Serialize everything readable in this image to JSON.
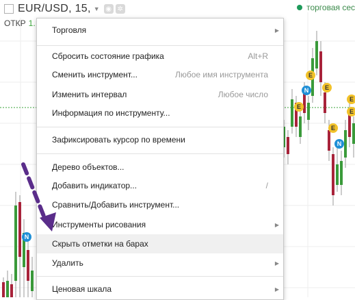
{
  "header": {
    "symbol": "EUR/USD, 15,",
    "ohlc_label": "ОТКР",
    "ohlc_value": "1.",
    "session_text": "торговая сес",
    "settings_icon": "gear-icon",
    "chart_icon": "chart-icon",
    "dropdown_icon": "chevron-down-icon"
  },
  "menu": {
    "trade": {
      "label": "Торговля"
    },
    "reset_state": {
      "label": "Сбросить состояние графика",
      "hint": "Alt+R"
    },
    "change_symbol": {
      "label": "Сменить инструмент...",
      "hint": "Любое имя инструмента"
    },
    "change_interval": {
      "label": "Изменить интервал",
      "hint": "Любое число"
    },
    "symbol_info": {
      "label": "Информация по инструменту..."
    },
    "lock_cursor": {
      "label": "Зафиксировать курсор по времени"
    },
    "object_tree": {
      "label": "Дерево объектов..."
    },
    "add_indicator": {
      "label": "Добавить индикатор...",
      "hint": "/"
    },
    "compare": {
      "label": "Сравнить/Добавить инструмент..."
    },
    "drawing_tools": {
      "label": "Инструменты рисования"
    },
    "hide_marks": {
      "label": "Скрыть отметки на барах"
    },
    "remove": {
      "label": "Удалить"
    },
    "price_scale": {
      "label": "Ценовая шкала"
    }
  },
  "markers": {
    "earnings": "E",
    "news": "N"
  },
  "colors": {
    "up_candle": "#3a9a3a",
    "down_candle": "#a8233a",
    "wick": "#9a9a9a",
    "earnings_badge": "#f2c22a",
    "news_badge": "#1f8fd6",
    "annotation_arrow": "#5a2d8a",
    "price_line": "#3aa33a"
  }
}
